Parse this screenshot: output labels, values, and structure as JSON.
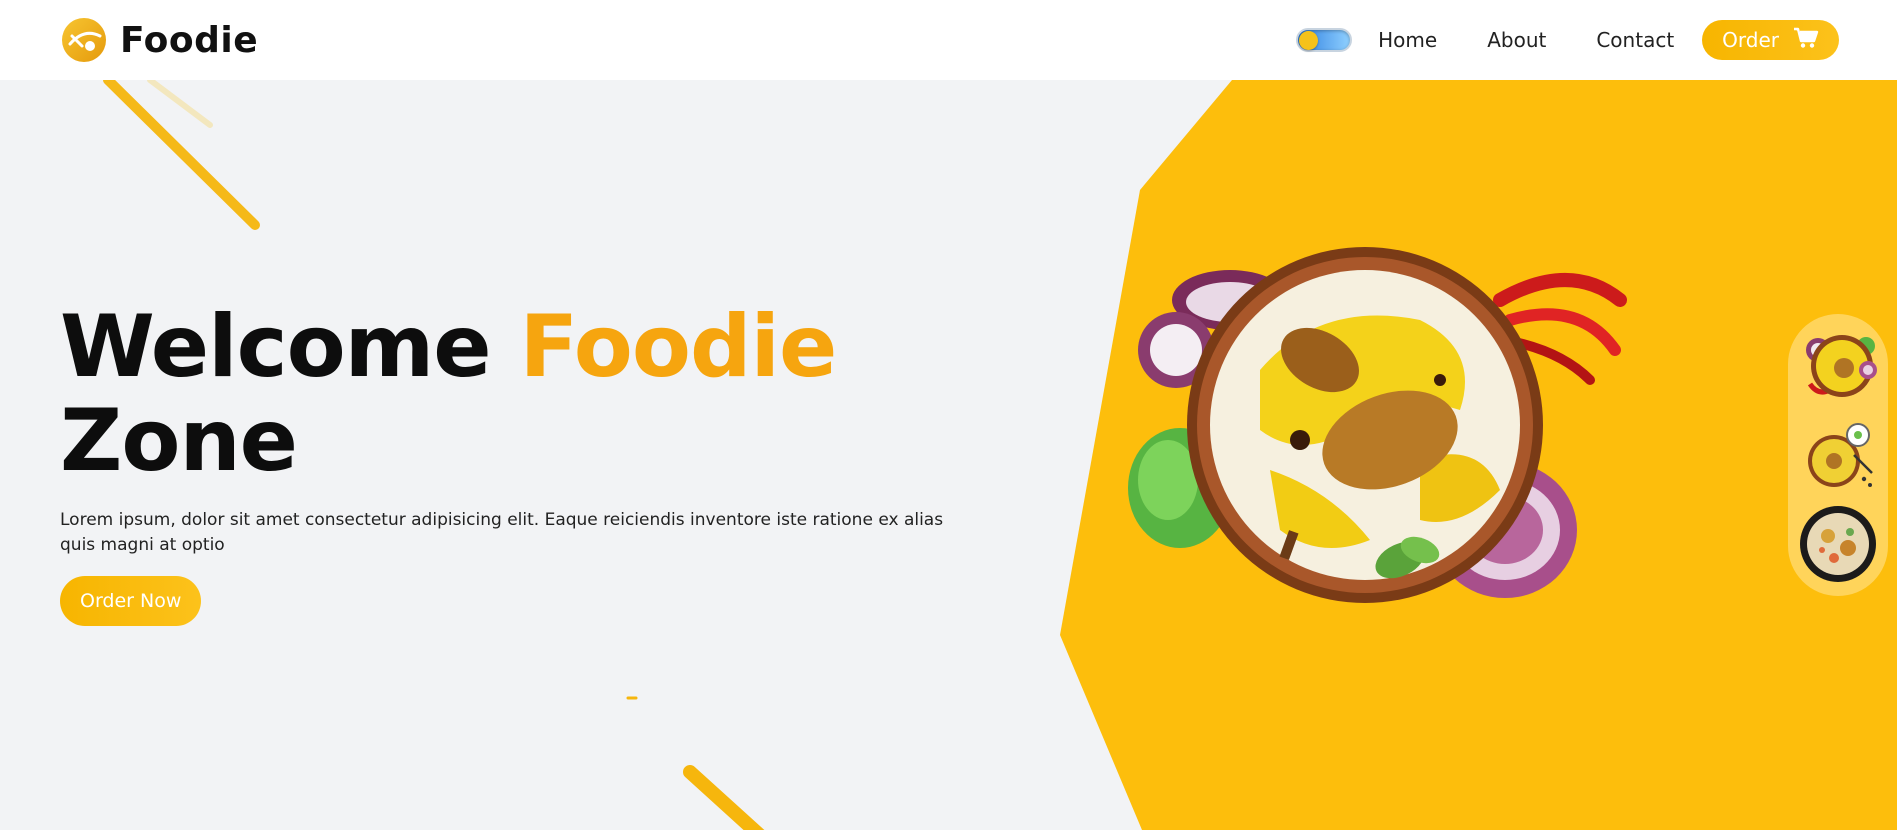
{
  "brand": {
    "name": "Foodie",
    "logo_icon": "fork-spoon-logo-icon"
  },
  "nav": {
    "theme_toggle": {
      "icon": "sun-sky-toggle-icon",
      "state": "light"
    },
    "links": [
      "Home",
      "About",
      "Contact"
    ],
    "order_button": {
      "label": "Order",
      "icon": "cart-icon"
    }
  },
  "hero": {
    "headline_part1": "Welcome ",
    "headline_accent": "Foodie",
    "headline_part2": "Zone",
    "description": "Lorem ipsum, dolor sit amet consectetur adipisicing elit. Eaque reiciendis inventore iste ratione ex alias quis magni at optio",
    "cta_label": "Order Now"
  },
  "dish": {
    "name": "biryani-bowl-image"
  },
  "thumbnails": [
    {
      "name": "biryani-thumb-1"
    },
    {
      "name": "biryani-thumb-2"
    },
    {
      "name": "biryani-thumb-3"
    }
  ],
  "colors": {
    "accent": "#f6a50f",
    "yellow_panel": "#fdbe0c",
    "background": "#f2f3f5",
    "rail": "#ffd45a"
  }
}
